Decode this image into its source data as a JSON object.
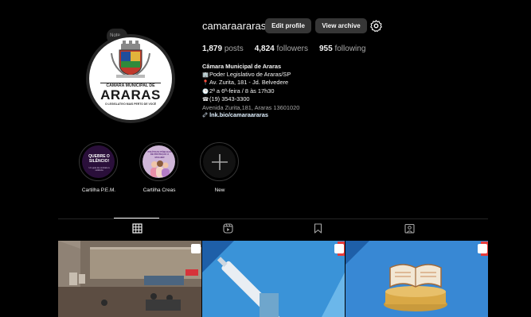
{
  "header": {
    "username": "camaraararas",
    "edit_profile": "Edit profile",
    "view_archive": "View archive"
  },
  "note": {
    "text": "Note..."
  },
  "avatar": {
    "line1": "CÂMARA MUNICIPAL DE",
    "line2": "ARARAS",
    "line3": "O LEGISLATIVO MAIS PERTO DE VOCÊ"
  },
  "stats": {
    "posts_count": "1,879",
    "posts_label": "posts",
    "followers_count": "4,824",
    "followers_label": "followers",
    "following_count": "955",
    "following_label": "following"
  },
  "bio": {
    "name": "Câmara Municipal de Araras",
    "line1": "Poder Legislativo de Araras/SP",
    "line2": "Av. Zurita, 181 - Jd. Belvedere",
    "line3": "2ª a 6ª-feira / 8 às 17h30",
    "line4": "(19) 3543-3300",
    "address": "Avenida Zurita,181, Araras 13601020",
    "link": "lnk.bio/camaraararas",
    "icon1": "🏢",
    "icon2": "📍",
    "icon3": "🕒",
    "icon4": "☎"
  },
  "highlights": [
    {
      "label": "Cartilha P.E.M.",
      "cover_title": "QUEBRE O SILÊNCIO!",
      "cover_sub": "Um guia de combate à violência"
    },
    {
      "label": "Cartilha Creas",
      "cover_title": "POLÍTICAS PÚBLICAS DE PROTEÇÃO À MULHER"
    },
    {
      "label": "New"
    }
  ],
  "colors": {
    "background": "#000000",
    "button": "#363636",
    "highlight_purple": "#2a0f3a",
    "link": "#e0f1ff"
  },
  "tabs": [
    "grid-icon",
    "reels-icon",
    "saved-icon",
    "tagged-icon"
  ]
}
